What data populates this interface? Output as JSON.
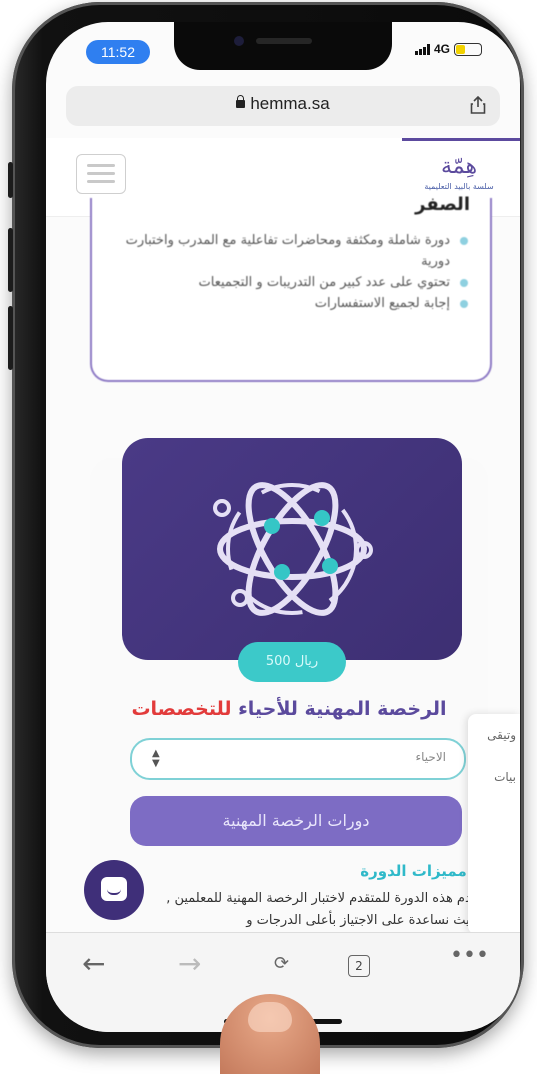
{
  "status": {
    "time": "11:52",
    "network": "4G"
  },
  "browser": {
    "url": "hemma.sa",
    "tab_count": "2"
  },
  "site": {
    "logo_sub": "سلسة بالبيد التعليمية"
  },
  "previous_card": {
    "title": "الصفر",
    "bullets": [
      "دورة شاملة ومكثفة ومحاضرات تفاعلية مع المدرب واختبارت دورية",
      "تحتوي على عدد كبير من التدريبات و التجميعات",
      "إجابة لجميع الاستفسارات"
    ]
  },
  "course": {
    "price": "500 ريال",
    "title_main": "الرخصة المهنية للأحياء ",
    "title_highlight": "للتخصصات",
    "select_value": "الاحياء",
    "button_label": "دورات الرخصة المهنية",
    "features_heading": "مميزات الدورة :",
    "features_text": "نقدم هذه الدورة للمتقدم لاختبار الرخصة المهنية للمعلمين , بحيث نساعدة على الاجتياز بأعلى الدرجات و"
  },
  "side_panel": {
    "item1": "وتيقى",
    "item2": "بيات"
  },
  "colors": {
    "brand": "#5c4a9e",
    "accent": "#3cc9c9",
    "highlight": "#e23b3b"
  }
}
